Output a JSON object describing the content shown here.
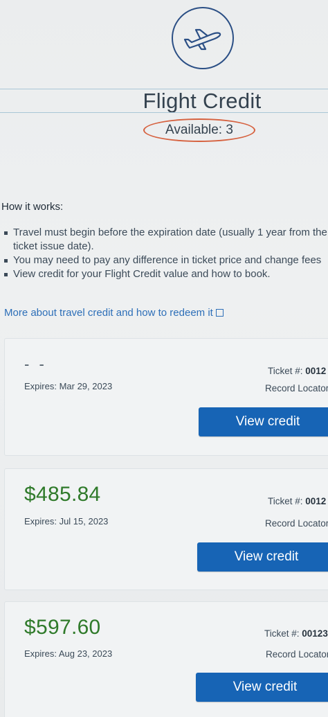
{
  "header": {
    "icon": "airplane-icon",
    "title": "Flight Credit",
    "available": "Available: 3",
    "highlight_color": "#d6613f"
  },
  "how_it_works": {
    "heading": "How it works:",
    "items": [
      {
        "line1": "Travel must begin before the expiration date (usually 1 year from the",
        "line2": "ticket issue date)."
      },
      {
        "line1": "You may need to pay any difference in ticket price and change fees"
      },
      {
        "line1": "View credit for your Flight Credit value and how to book."
      }
    ]
  },
  "more_link": {
    "label": "More about travel credit and how to redeem it",
    "icon": "external-link-icon"
  },
  "credits": [
    {
      "amount": "- -",
      "expires": "Expires: Mar 29, 2023",
      "ticket_label": "Ticket #:",
      "ticket_value": "0012",
      "locator_label": "Record Locator",
      "button_label": "View credit"
    },
    {
      "amount": "$485.84",
      "expires": "Expires: Jul 15, 2023",
      "ticket_label": "Ticket #:",
      "ticket_value": "0012",
      "locator_label": "Record Locator",
      "button_label": "View credit"
    },
    {
      "amount": "$597.60",
      "expires": "Expires: Aug 23, 2023",
      "ticket_label": "Ticket #:",
      "ticket_value": "00123",
      "locator_label": "Record Locator",
      "button_label": "View credit"
    }
  ],
  "colors": {
    "accent_blue": "#1764b5",
    "amount_green": "#2f7a2a",
    "link_blue": "#2d6fb8"
  }
}
